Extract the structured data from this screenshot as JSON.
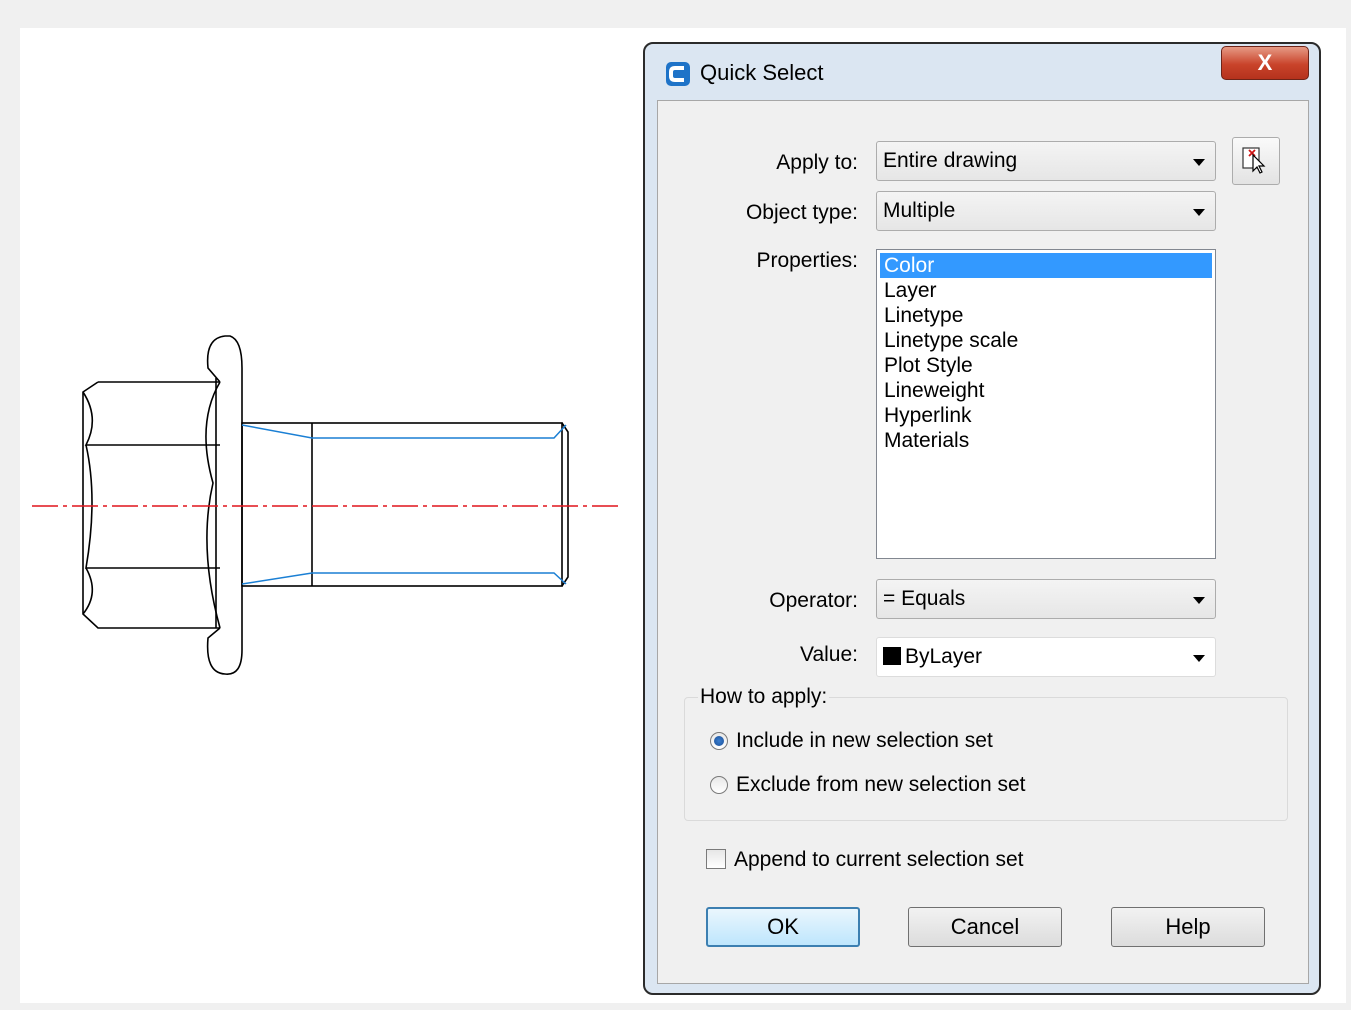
{
  "dialog": {
    "title": "Quick Select",
    "close_label": "X",
    "apply_to": {
      "label": "Apply to:",
      "value": "Entire drawing"
    },
    "object_type": {
      "label": "Object type:",
      "value": "Multiple"
    },
    "properties": {
      "label": "Properties:",
      "items": [
        "Color",
        "Layer",
        "Linetype",
        "Linetype scale",
        "Plot Style",
        "Lineweight",
        "Hyperlink",
        "Materials"
      ],
      "selected": "Color"
    },
    "operator": {
      "label": "Operator:",
      "value": "= Equals"
    },
    "value": {
      "label": "Value:",
      "value": "ByLayer",
      "swatch_color": "#000000"
    },
    "how_to_apply": {
      "title": "How to apply:",
      "include_label": "Include in new selection set",
      "exclude_label": "Exclude from new selection set",
      "selected": "include"
    },
    "append": {
      "label": "Append to current selection set",
      "checked": false
    },
    "buttons": {
      "ok": "OK",
      "cancel": "Cancel",
      "help": "Help"
    }
  },
  "colors": {
    "selection": "#3399ff",
    "centerline": "#e0141c",
    "thread_line": "#1a7fd4",
    "close_button": "#c9432a"
  }
}
